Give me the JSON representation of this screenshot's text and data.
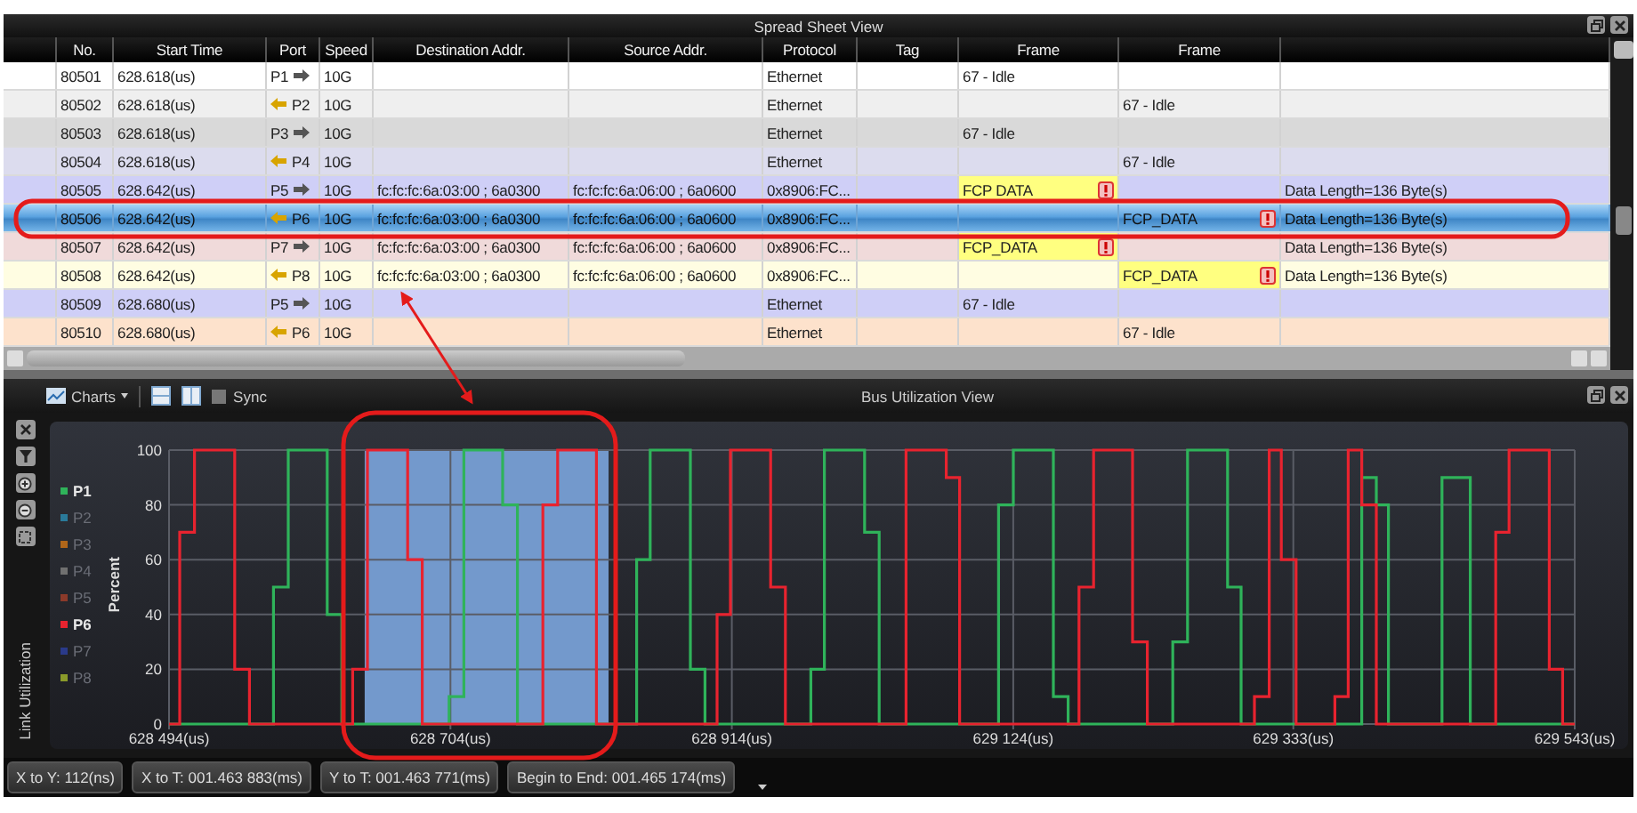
{
  "spreadsheet": {
    "title": "Spread Sheet View",
    "columns": [
      "No.",
      "Start Time",
      "Port",
      "Speed",
      "Destination Addr.",
      "Source Addr.",
      "Protocol",
      "Tag",
      "Frame",
      "Frame"
    ],
    "rows": [
      {
        "no": "80501",
        "start_time": "628.618(us)",
        "port": "P1",
        "kind": "outbound",
        "speed": "10G",
        "protocol": "Ethernet",
        "frame_1": {
          "text": "67 - Idle",
          "alert": false
        },
        "color": "#ffffff",
        "selected": false
      },
      {
        "no": "80502",
        "start_time": "628.618(us)",
        "port": "P2",
        "kind": "inbound",
        "speed": "10G",
        "protocol": "Ethernet",
        "frame_2": {
          "text": "67 - Idle",
          "alert": false
        },
        "color": "#efefef",
        "selected": false
      },
      {
        "no": "80503",
        "start_time": "628.618(us)",
        "port": "P3",
        "kind": "outbound",
        "speed": "10G",
        "protocol": "Ethernet",
        "frame_1": {
          "text": "67 - Idle",
          "alert": false
        },
        "color": "#d9d9d9",
        "selected": false
      },
      {
        "no": "80504",
        "start_time": "628.618(us)",
        "port": "P4",
        "kind": "inbound",
        "speed": "10G",
        "protocol": "Ethernet",
        "frame_2": {
          "text": "67 - Idle",
          "alert": false
        },
        "color": "#dcdcee",
        "selected": false
      },
      {
        "no": "80505",
        "start_time": "628.642(us)",
        "port": "P5",
        "kind": "outbound",
        "speed": "10G",
        "destination": "fc:fc:fc:6a:03:00 ; 6a0300",
        "source": "fc:fc:fc:6a:06:00 ; 6a0600",
        "protocol": "0x8906:FC...",
        "frame_1": {
          "text": "FCP DATA",
          "alert": true
        },
        "info": "Data Length=136 Byte(s)",
        "color": "#cfcff7",
        "selected": false
      },
      {
        "no": "80506",
        "start_time": "628.642(us)",
        "port": "P6",
        "kind": "inbound",
        "speed": "10G",
        "destination": "fc:fc:fc:6a:03:00 ; 6a0300",
        "source": "fc:fc:fc:6a:06:00 ; 6a0600",
        "protocol": "0x8906:FC...",
        "frame_2": {
          "text": "FCP_DATA",
          "alert": true
        },
        "info": "Data Length=136 Byte(s)",
        "selected": true
      },
      {
        "no": "80507",
        "start_time": "628.642(us)",
        "port": "P7",
        "kind": "outbound",
        "speed": "10G",
        "destination": "fc:fc:fc:6a:03:00 ; 6a0300",
        "source": "fc:fc:fc:6a:06:00 ; 6a0600",
        "protocol": "0x8906:FC...",
        "frame_1": {
          "text": "FCP_DATA",
          "alert": true
        },
        "info": "Data Length=136 Byte(s)",
        "color": "#f0dada",
        "selected": false
      },
      {
        "no": "80508",
        "start_time": "628.642(us)",
        "port": "P8",
        "kind": "inbound",
        "speed": "10G",
        "destination": "fc:fc:fc:6a:03:00 ; 6a0300",
        "source": "fc:fc:fc:6a:06:00 ; 6a0600",
        "protocol": "0x8906:FC...",
        "frame_2": {
          "text": "FCP_DATA",
          "alert": true
        },
        "info": "Data Length=136 Byte(s)",
        "color": "#fffde2",
        "selected": false
      },
      {
        "no": "80509",
        "start_time": "628.680(us)",
        "port": "P5",
        "kind": "outbound",
        "speed": "10G",
        "protocol": "Ethernet",
        "frame_1": {
          "text": "67 - Idle",
          "alert": false
        },
        "color": "#cfcff7",
        "selected": false
      },
      {
        "no": "80510",
        "start_time": "628.680(us)",
        "port": "P6",
        "kind": "inbound",
        "speed": "10G",
        "protocol": "Ethernet",
        "frame_2": {
          "text": "67 - Idle",
          "alert": false
        },
        "color": "#fde2cc",
        "selected": false
      }
    ]
  },
  "bus_view": {
    "title": "Bus Utilization View",
    "charts_menu": "Charts",
    "sync": {
      "label": "Sync",
      "checked": false
    },
    "side_label": "Link Utilization",
    "legend": [
      {
        "name": "P1",
        "color": "#2fb35a",
        "on": true
      },
      {
        "name": "P2",
        "color": "#2a7a9a",
        "on": false
      },
      {
        "name": "P3",
        "color": "#b0661a",
        "on": false
      },
      {
        "name": "P4",
        "color": "#707070",
        "on": false
      },
      {
        "name": "P5",
        "color": "#8b3a2a",
        "on": false
      },
      {
        "name": "P6",
        "color": "#e8232f",
        "on": true
      },
      {
        "name": "P7",
        "color": "#2a3a8a",
        "on": false
      },
      {
        "name": "P8",
        "color": "#8a9a2a",
        "on": false
      }
    ],
    "chart_data": {
      "type": "line",
      "ylabel": "Percent",
      "xlim": [
        628494,
        629543
      ],
      "ylim": [
        0,
        100
      ],
      "grid": true,
      "x": [
        628494,
        628502,
        628502,
        628513,
        628513,
        628543,
        628543,
        628554,
        628554,
        628572,
        628572,
        628583,
        628583,
        628612,
        628612,
        628623,
        628623,
        628631,
        628631,
        628642,
        628642,
        628672,
        628672,
        628683,
        628683,
        628703,
        628703,
        628714,
        628714,
        628743,
        628743,
        628754,
        628754,
        628773,
        628773,
        628784,
        628784,
        628813,
        628813,
        628843,
        628843,
        628853,
        628853,
        628883,
        628883,
        628894,
        628894,
        628903,
        628903,
        628913,
        628913,
        628943,
        628943,
        628954,
        628954,
        628973,
        628973,
        628983,
        628983,
        629013,
        629013,
        629024,
        629024,
        629044,
        629044,
        629074,
        629074,
        629084,
        629084,
        629113,
        629113,
        629124,
        629124,
        629154,
        629154,
        629165,
        629165,
        629173,
        629173,
        629184,
        629184,
        629213,
        629213,
        629224,
        629224,
        629243,
        629243,
        629254,
        629254,
        629284,
        629284,
        629294,
        629294,
        629304,
        629304,
        629315,
        629315,
        629324,
        629324,
        629335,
        629335,
        629364,
        629364,
        629374,
        629374,
        629384,
        629384,
        629395,
        629395,
        629404,
        629404,
        629444,
        629444,
        629465,
        629465,
        629484,
        629484,
        629494,
        629494,
        629524,
        629524,
        629534,
        629534,
        629543,
        629543
      ],
      "series": [
        {
          "color": "#2fb35a",
          "values": [
            0,
            0,
            0,
            0,
            0,
            0,
            0,
            0,
            0,
            0,
            50,
            50,
            100,
            100,
            40,
            40,
            0,
            0,
            0,
            0,
            0,
            0,
            0,
            0,
            0,
            0,
            10,
            10,
            100,
            100,
            80,
            80,
            0,
            0,
            0,
            0,
            0,
            0,
            0,
            0,
            60,
            60,
            100,
            100,
            20,
            20,
            0,
            0,
            0,
            0,
            0,
            0,
            0,
            0,
            0,
            0,
            20,
            20,
            100,
            100,
            70,
            70,
            0,
            0,
            0,
            0,
            0,
            0,
            0,
            0,
            80,
            80,
            100,
            100,
            10,
            10,
            0,
            0,
            0,
            0,
            0,
            0,
            0,
            0,
            0,
            0,
            30,
            30,
            100,
            100,
            50,
            50,
            0,
            0,
            0,
            0,
            0,
            0,
            0,
            0,
            0,
            0,
            0,
            0,
            0,
            0,
            90,
            90,
            80,
            80,
            0,
            0,
            90,
            90,
            0,
            0,
            0,
            0,
            0,
            0,
            0,
            0,
            0,
            0,
            0
          ]
        },
        {
          "color": "#e8232f",
          "values": [
            0,
            0,
            70,
            70,
            100,
            100,
            20,
            20,
            0,
            0,
            0,
            0,
            0,
            0,
            0,
            0,
            0,
            0,
            20,
            20,
            100,
            100,
            60,
            60,
            0,
            0,
            0,
            0,
            0,
            0,
            0,
            0,
            0,
            0,
            80,
            80,
            100,
            100,
            0,
            0,
            0,
            0,
            0,
            0,
            0,
            0,
            0,
            0,
            40,
            40,
            100,
            100,
            50,
            50,
            0,
            0,
            0,
            0,
            0,
            0,
            0,
            0,
            0,
            0,
            100,
            100,
            90,
            90,
            0,
            0,
            0,
            0,
            0,
            0,
            0,
            0,
            0,
            0,
            50,
            50,
            100,
            100,
            30,
            30,
            0,
            0,
            0,
            0,
            0,
            0,
            0,
            0,
            0,
            0,
            10,
            10,
            100,
            100,
            60,
            60,
            0,
            0,
            10,
            10,
            100,
            100,
            80,
            80,
            0,
            0,
            0,
            0,
            0,
            0,
            0,
            0,
            70,
            70,
            100,
            100,
            20,
            20,
            0,
            0,
            0
          ]
        }
      ],
      "xticks": [
        {
          "value": 628494,
          "label": "628 494(us)"
        },
        {
          "value": 628704,
          "label": "628 704(us)"
        },
        {
          "value": 628914,
          "label": "628 914(us)"
        },
        {
          "value": 629124,
          "label": "629 124(us)"
        },
        {
          "value": 629333,
          "label": "629 333(us)"
        },
        {
          "value": 629543,
          "label": "629 543(us)"
        }
      ],
      "yticks": [
        0,
        20,
        40,
        60,
        80,
        100
      ],
      "bands": [
        {
          "axis": "x",
          "from": 628640,
          "to": 628822,
          "color": "#7399cc"
        }
      ]
    }
  },
  "status_bar": {
    "readings": [
      "X to Y: 112(ns)",
      "X to T: 001.463 883(ms)",
      "Y to T: 001.463 771(ms)",
      "Begin to End: 001.465 174(ms)"
    ]
  }
}
